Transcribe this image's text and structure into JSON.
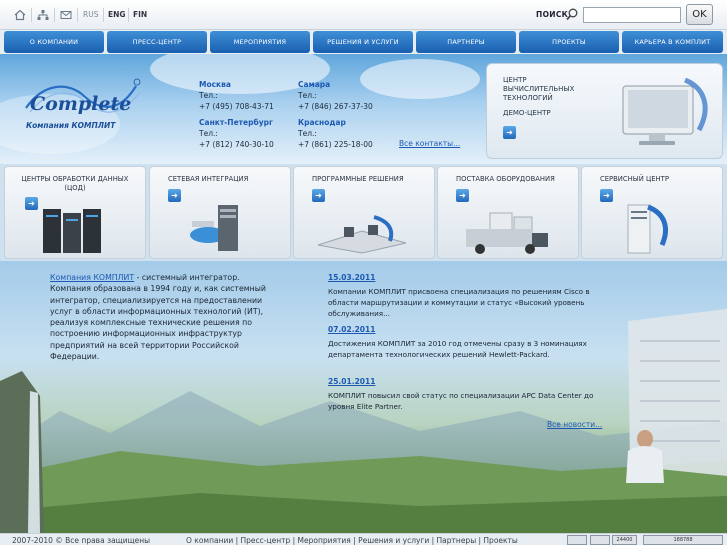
{
  "topbar": {
    "icons": [
      "home-icon",
      "sitemap-icon",
      "mail-icon"
    ],
    "languages": [
      "RUS",
      "ENG",
      "FIN"
    ],
    "search_label": "ПОИСК",
    "search_value": "",
    "ok_label": "OK"
  },
  "nav": {
    "items": [
      "О КОМПАНИИ",
      "ПРЕСС-ЦЕНТР",
      "МЕРОПРИЯТИЯ",
      "РЕШЕНИЯ И УСЛУГИ",
      "ПАРТНЕРЫ",
      "ПРОЕКТЫ",
      "КАРЬЕРА В КОМПЛИТ"
    ]
  },
  "header": {
    "logo_text": "Complete",
    "logo_subtitle": "Компания КОМПЛИТ",
    "contacts": [
      {
        "city": "Москва",
        "tel_label": "Тел.:",
        "phone": "+7 (495) 708-43-71"
      },
      {
        "city": "Самара",
        "tel_label": "Тел.:",
        "phone": "+7 (846) 267-37-30"
      },
      {
        "city": "Санкт-Петербург",
        "tel_label": "Тел.:",
        "phone": "+7 (812) 740-30-10"
      },
      {
        "city": "Краснодар",
        "tel_label": "Тел.:",
        "phone": "+7 (861) 225-18-00"
      }
    ],
    "all_contacts": "Все контакты...",
    "demo": {
      "title_lines": [
        "ЦЕНТР",
        "ВЫЧИСЛИТЕЛЬНЫХ",
        "ТЕХНОЛОГИЙ"
      ],
      "subtitle": "ДЕМО-ЦЕНТР"
    }
  },
  "categories": [
    {
      "line1": "ЦЕНТРЫ ОБРАБОТКИ ДАННЫХ",
      "line2": "(ЦОД)"
    },
    {
      "line1": "СЕТЕВАЯ ИНТЕГРАЦИЯ",
      "line2": ""
    },
    {
      "line1": "ПРОГРАММНЫЕ РЕШЕНИЯ",
      "line2": ""
    },
    {
      "line1": "ПОСТАВКА ОБОРУДОВАНИЯ",
      "line2": ""
    },
    {
      "line1": "СЕРВИСНЫЙ ЦЕНТР",
      "line2": ""
    }
  ],
  "intro": {
    "company_link": "Компания КОМПЛИТ",
    "text": " - системный интегратор. Компания образована в 1994 году и, как системный интегратор, специализируется на предоставлении услуг в области информационных технологий (ИТ), реализуя комплексные технические решения по построению информационных инфраструктур предприятий на всей территории Российской Федерации."
  },
  "news": [
    {
      "date": "15.03.2011",
      "text": "Компании КОМПЛИТ присвоена специализация по решениям Cisco в области маршрутизации и коммутации и статус «Высокий уровень обслуживания..."
    },
    {
      "date": "07.02.2011",
      "text": "Достижения КОМПЛИТ за 2010 год отмечены сразу в 3 номинациях департамента технологических решений Hewlett-Packard."
    },
    {
      "date": "25.01.2011",
      "text": "КОМПЛИТ повысил свой статус по специализации APC Data Center до уровня Elite Partner."
    }
  ],
  "all_news": "Все новости...",
  "footer": {
    "copyright": "2007-2010 © Все права защищены",
    "links": [
      "О компании",
      "Пресс-центр",
      "Мероприятия",
      "Решения и услуги",
      "Партнеры",
      "Проекты"
    ],
    "separator": " | ",
    "counter_labels": [
      "24400",
      "188788"
    ]
  },
  "colors": {
    "nav_blue": "#1a5fb0",
    "link_blue": "#1d59b3"
  }
}
